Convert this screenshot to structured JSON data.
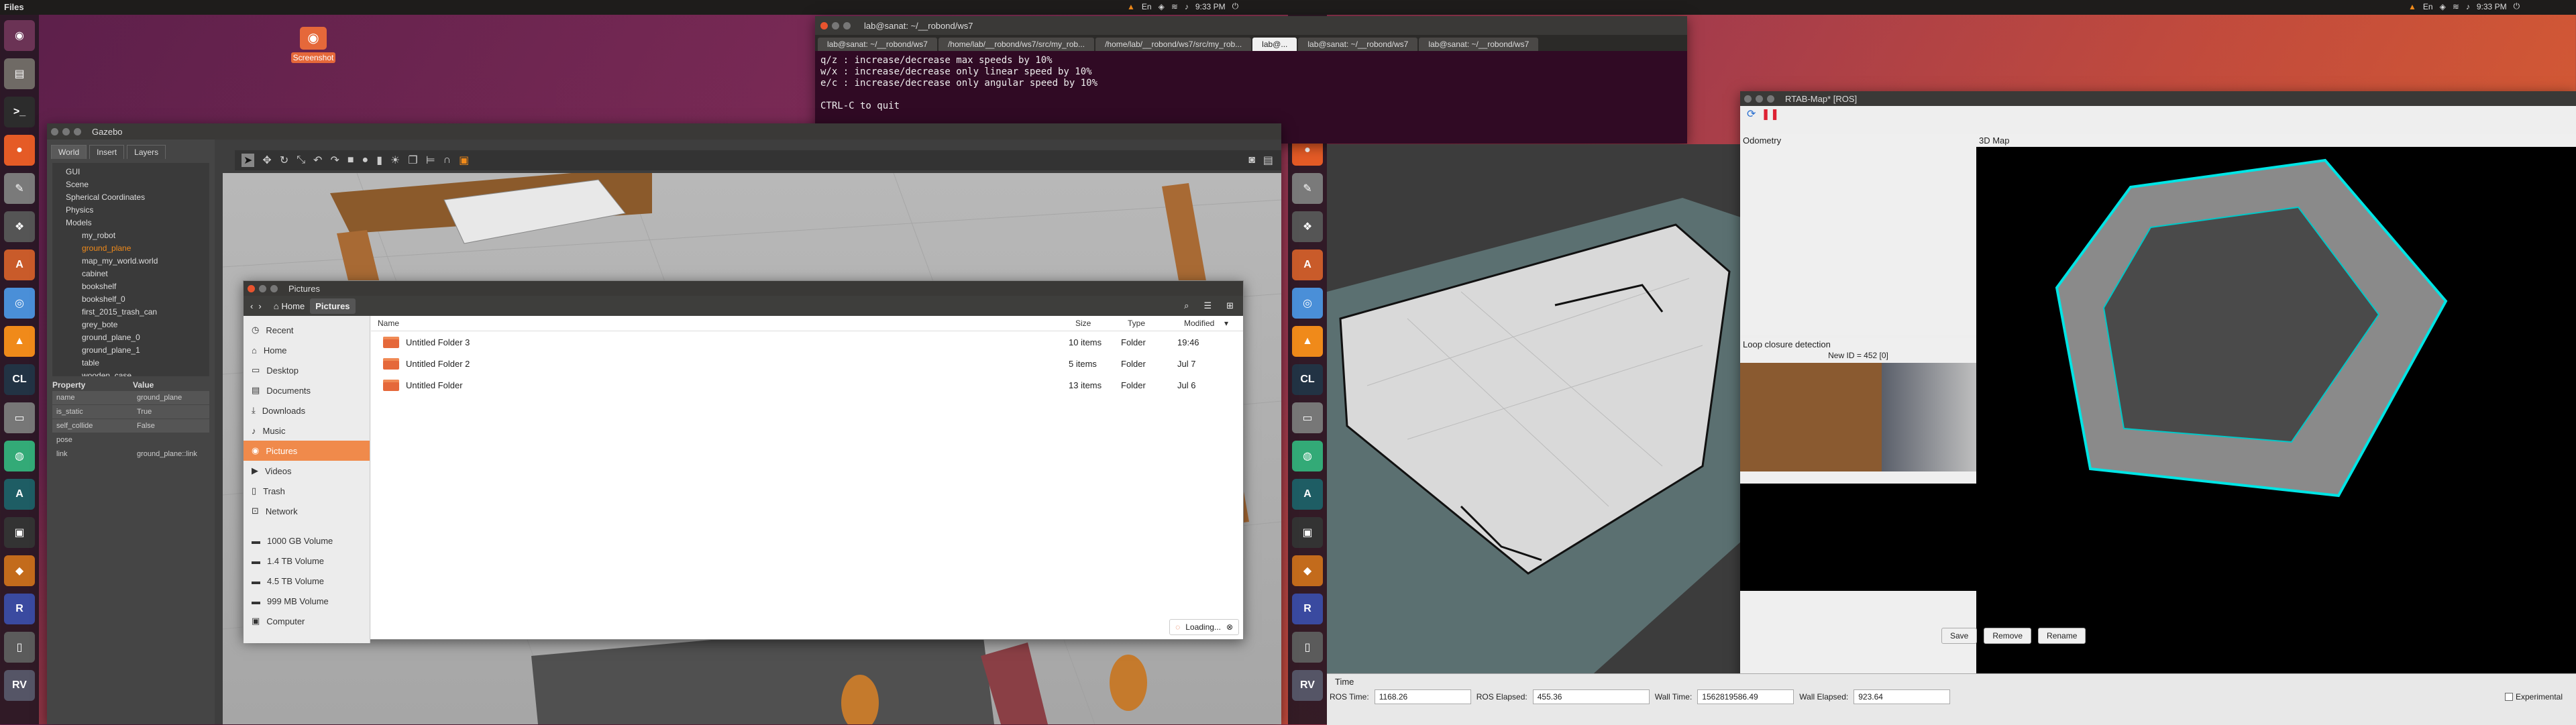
{
  "topbar": {
    "left_title": "Files",
    "tray_left": {
      "time": "9:33 PM",
      "icons": [
        "vlc-icon",
        "keyboard-icon",
        "dropbox-icon",
        "wifi-icon",
        "volume-icon",
        "power-icon"
      ]
    },
    "tray_right": {
      "time": "9:33 PM"
    }
  },
  "desktop": {
    "icon_label": "Screenshot"
  },
  "launcher": {
    "items": [
      {
        "name": "ubuntu-icon",
        "color": "#6b3355",
        "glyph": "◉"
      },
      {
        "name": "files-icon",
        "color": "#6f6a65",
        "glyph": "▤"
      },
      {
        "name": "terminal-icon",
        "color": "#2c2c2c",
        "glyph": ">_"
      },
      {
        "name": "firefox-icon",
        "color": "#e55b26",
        "glyph": "●"
      },
      {
        "name": "text-editor-icon",
        "color": "#7a7a7a",
        "glyph": "✎"
      },
      {
        "name": "geany-icon",
        "color": "#555",
        "glyph": "❖"
      },
      {
        "name": "software-icon",
        "color": "#c95b2a",
        "glyph": "A"
      },
      {
        "name": "chromium-icon",
        "color": "#4a8fd8",
        "glyph": "◎"
      },
      {
        "name": "vlc-icon",
        "color": "#f08a1a",
        "glyph": "▲"
      },
      {
        "name": "cl-icon",
        "color": "#234",
        "glyph": "CL"
      },
      {
        "name": "disk-icon",
        "color": "#777",
        "glyph": "▭"
      },
      {
        "name": "chrome-icon",
        "color": "#3a7",
        "glyph": "◍"
      },
      {
        "name": "arduino-icon",
        "color": "#1e5d64",
        "glyph": "A"
      },
      {
        "name": "display-icon",
        "color": "#333",
        "glyph": "▣"
      },
      {
        "name": "virtualbox-icon",
        "color": "#c36b1c",
        "glyph": "◆"
      },
      {
        "name": "rviz-icon",
        "color": "#3a4aa0",
        "glyph": "R"
      },
      {
        "name": "trash-icon",
        "color": "#5b5b5b",
        "glyph": "▯"
      },
      {
        "name": "rv-icon",
        "color": "#556",
        "glyph": "RV"
      }
    ]
  },
  "terminal": {
    "tabs": [
      "lab@sanat: ~/__robond/ws7",
      "/home/lab/__robond/ws7/src/my_rob...",
      "/home/lab/__robond/ws7/src/my_rob...",
      "lab@...",
      "lab@sanat: ~/__robond/ws7",
      "lab@sanat: ~/__robond/ws7"
    ],
    "title": "lab@sanat: ~/__robond/ws7",
    "lines": [
      "q/z : increase/decrease max speeds by 10%",
      "w/x : increase/decrease only linear speed by 10%",
      "e/c : increase/decrease only angular speed by 10%",
      "",
      "CTRL-C to quit"
    ]
  },
  "gazebo": {
    "title": "Gazebo",
    "tabs": [
      "World",
      "Insert",
      "Layers"
    ],
    "tree": [
      "GUI",
      "Scene",
      "Spherical Coordinates",
      "Physics",
      "Models",
      "my_robot",
      "ground_plane",
      "map_my_world.world",
      "cabinet",
      "bookshelf",
      "bookshelf_0",
      "first_2015_trash_can",
      "grey_bote",
      "ground_plane_0",
      "ground_plane_1",
      "table",
      "wooden_case"
    ],
    "prop_header": [
      "Property",
      "Value"
    ],
    "props": [
      {
        "k": "name",
        "v": "ground_plane"
      },
      {
        "k": "is_static",
        "v": "True"
      },
      {
        "k": "self_collide",
        "v": "False"
      },
      {
        "k": "pose",
        "v": ""
      },
      {
        "k": "link",
        "v": "ground_plane::link"
      }
    ]
  },
  "files": {
    "title": "Pictures",
    "path": [
      "Home",
      "Pictures"
    ],
    "sidebar": [
      {
        "label": "Recent",
        "icon": "clock-icon"
      },
      {
        "label": "Home",
        "icon": "home-icon"
      },
      {
        "label": "Desktop",
        "icon": "desktop-icon"
      },
      {
        "label": "Documents",
        "icon": "documents-icon"
      },
      {
        "label": "Downloads",
        "icon": "download-icon"
      },
      {
        "label": "Music",
        "icon": "music-icon"
      },
      {
        "label": "Pictures",
        "icon": "camera-icon"
      },
      {
        "label": "Videos",
        "icon": "video-icon"
      },
      {
        "label": "Trash",
        "icon": "trash-icon"
      },
      {
        "label": "Network",
        "icon": "network-icon"
      },
      {
        "label": "1000 GB Volume",
        "icon": "drive-icon"
      },
      {
        "label": "1.4 TB Volume",
        "icon": "drive-icon"
      },
      {
        "label": "4.5 TB Volume",
        "icon": "drive-icon"
      },
      {
        "label": "999 MB Volume",
        "icon": "drive-icon"
      },
      {
        "label": "Computer",
        "icon": "computer-icon"
      }
    ],
    "columns": [
      "Name",
      "Size",
      "Type",
      "Modified"
    ],
    "rows": [
      {
        "name": "Untitled Folder 3",
        "size": "10 items",
        "type": "Folder",
        "modified": "19:46"
      },
      {
        "name": "Untitled Folder 2",
        "size": "5 items",
        "type": "Folder",
        "modified": "Jul 7"
      },
      {
        "name": "Untitled Folder",
        "size": "13 items",
        "type": "Folder",
        "modified": "Jul 6"
      }
    ],
    "status": "Loading..."
  },
  "rtabmap": {
    "title": "RTAB-Map* [ROS]",
    "odometry_label": "Odometry",
    "map3d_label": "3D Map",
    "loop_label": "Loop closure detection",
    "new_id": "New ID = 452 [0]",
    "buttons": [
      "Save",
      "Remove",
      "Rename"
    ]
  },
  "timebar": {
    "title": "Time",
    "ros_time_label": "ROS Time:",
    "ros_time": "1168.26",
    "ros_elapsed_label": "ROS Elapsed:",
    "ros_elapsed": "455.36",
    "wall_time_label": "Wall Time:",
    "wall_time": "1562819586.49",
    "wall_elapsed_label": "Wall Elapsed:",
    "wall_elapsed": "923.64",
    "experimental_label": "Experimental"
  }
}
